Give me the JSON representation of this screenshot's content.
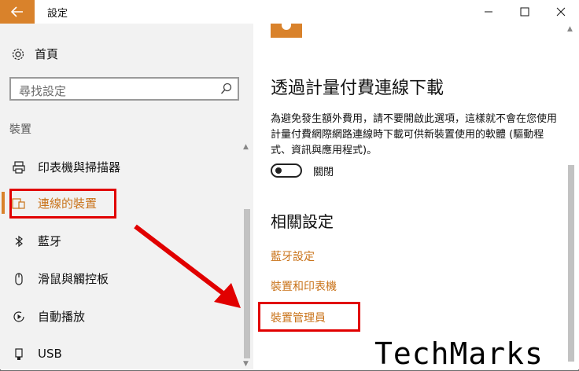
{
  "window": {
    "title": "設定",
    "back_icon": "back-arrow-icon",
    "controls": [
      "minimize-icon",
      "maximize-icon",
      "close-icon"
    ]
  },
  "sidebar": {
    "home": "首頁",
    "search_placeholder": "尋找設定",
    "section": "裝置",
    "items": [
      {
        "label": "印表機與掃描器",
        "icon": "printer-icon"
      },
      {
        "label": "連線的裝置",
        "icon": "connected-devices-icon",
        "selected": true
      },
      {
        "label": "藍牙",
        "icon": "bluetooth-icon"
      },
      {
        "label": "滑鼠與觸控板",
        "icon": "mouse-icon"
      },
      {
        "label": "自動播放",
        "icon": "autoplay-icon"
      },
      {
        "label": "USB",
        "icon": "usb-icon"
      }
    ]
  },
  "content": {
    "metered_title": "透過計量付費連線下載",
    "metered_desc": "為避免發生額外費用，請不要開啟此選項，這樣就不會在您使用計量付費網際網路連線時下載可供新裝置使用的軟體 (驅動程式、資訊與應用程式)。",
    "toggle_state": "關閉",
    "related_title": "相關設定",
    "links": [
      "藍牙設定",
      "裝置和印表機",
      "裝置管理員"
    ]
  },
  "colors": {
    "accent": "#d9822b",
    "annotation": "#e10000"
  },
  "watermark": "TechMarks"
}
